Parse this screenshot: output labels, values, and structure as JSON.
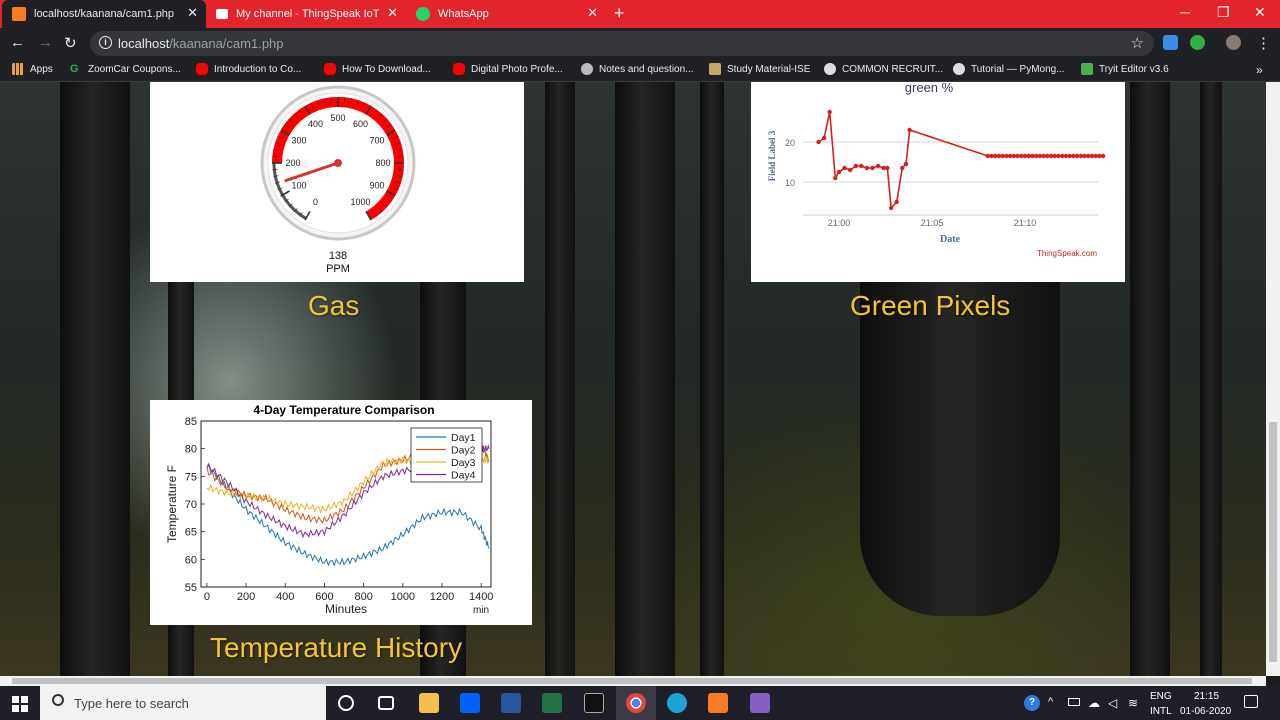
{
  "tabs": [
    {
      "title": "localhost/kaanana/cam1.php",
      "active": true,
      "icon": "xampp-icon"
    },
    {
      "title": "My channel - ThingSpeak IoT",
      "active": false,
      "icon": "thingspeak-icon"
    },
    {
      "title": "WhatsApp",
      "active": false,
      "icon": "whatsapp-icon"
    }
  ],
  "address_bar": {
    "host": "localhost",
    "path": "/kaanana/cam1.php"
  },
  "bookmarks": [
    {
      "label": "Apps",
      "icon": "apps-grid-icon"
    },
    {
      "label": "ZoomCar Coupons...",
      "icon": "g-icon"
    },
    {
      "label": "Introduction to Co...",
      "icon": "youtube-icon"
    },
    {
      "label": "How To Download...",
      "icon": "youtube-icon"
    },
    {
      "label": "Digital Photo Profe...",
      "icon": "youtube-icon"
    },
    {
      "label": "Notes and question...",
      "icon": "github-icon"
    },
    {
      "label": "Study Material-ISE",
      "icon": "image-icon"
    },
    {
      "label": "COMMON RECRUIT...",
      "icon": "globe-icon"
    },
    {
      "label": "Tutorial — PyMong...",
      "icon": "globe-icon"
    },
    {
      "label": "Tryit Editor v3.6",
      "icon": "w3-icon"
    }
  ],
  "gauge": {
    "value": 138,
    "unit": "PPM",
    "min": 0,
    "max": 1000,
    "tick_labels": [
      "0",
      "100",
      "200",
      "300",
      "400",
      "500",
      "600",
      "700",
      "800",
      "900",
      "1000"
    ],
    "red_band": [
      200,
      1000
    ],
    "caption": "Gas"
  },
  "green_chart": {
    "title": "green %",
    "xlabel": "Date",
    "ylabel": "Field Label 3",
    "x_ticks": [
      "21:00",
      "21:05",
      "21:10"
    ],
    "y_ticks": [
      "10",
      "20"
    ],
    "credit": "ThingSpeak.com",
    "caption": "Green Pixels"
  },
  "temp_chart": {
    "title": "4-Day Temperature Comparison",
    "xlabel": "Minutes",
    "ylabel": "Temperature F",
    "x_unit": "min",
    "x_ticks": [
      "0",
      "200",
      "400",
      "600",
      "800",
      "1000",
      "1200",
      "1400"
    ],
    "y_ticks": [
      "55",
      "60",
      "65",
      "70",
      "75",
      "80",
      "85"
    ],
    "caption": "Temperature History"
  },
  "chart_data": [
    {
      "type": "line",
      "title": "green %",
      "xlabel": "Date",
      "ylabel": "Field Label 3",
      "ylim": [
        0,
        28
      ],
      "x_tick_labels": [
        "21:00",
        "21:05",
        "21:10"
      ],
      "color": "#d62020",
      "series": [
        {
          "x": [
            "20:58.9",
            "20:59.2",
            "20:59.5",
            "20:59.8",
            "21:00.0",
            "21:00.3",
            "21:00.6",
            "21:00.9",
            "21:01.2",
            "21:01.5",
            "21:01.8",
            "21:02.1",
            "21:02.4",
            "21:02.6",
            "21:02.8",
            "21:03.1",
            "21:03.4",
            "21:03.6",
            "21:03.8",
            "21:08.0",
            "21:08.2",
            "21:08.4",
            "21:08.6",
            "21:08.8",
            "21:09.0",
            "21:09.2",
            "21:09.4",
            "21:09.6",
            "21:09.8",
            "21:10.0",
            "21:10.2",
            "21:10.4",
            "21:10.6",
            "21:10.8",
            "21:11.0",
            "21:11.2",
            "21:11.4",
            "21:11.6",
            "21:11.8",
            "21:12.0",
            "21:12.2",
            "21:12.4",
            "21:12.6",
            "21:12.8",
            "21:13.0",
            "21:13.2",
            "21:13.4",
            "21:13.6",
            "21:13.8",
            "21:14.0",
            "21:14.2"
          ],
          "values": [
            20,
            21,
            27.5,
            11,
            12.5,
            13.5,
            13,
            14,
            14,
            13.5,
            13.5,
            14,
            13.5,
            13.5,
            3.5,
            5,
            13.5,
            14.5,
            23,
            16.5,
            16.5,
            16.5,
            16.5,
            16.5,
            16.5,
            16.5,
            16.5,
            16.5,
            16.5,
            16.5,
            16.5,
            16.5,
            16.5,
            16.5,
            16.5,
            16.5,
            16.5,
            16.5,
            16.5,
            16.5,
            16.5,
            16.5,
            16.5,
            16.5,
            16.5,
            16.5,
            16.5,
            16.5,
            16.5,
            16.5,
            16.5
          ]
        }
      ]
    },
    {
      "type": "line",
      "title": "4-Day Temperature Comparison",
      "xlabel": "Minutes",
      "ylabel": "Temperature F",
      "xlim": [
        -30,
        1450
      ],
      "ylim": [
        55,
        85
      ],
      "legend": "top-right",
      "x": [
        0,
        100,
        200,
        300,
        400,
        500,
        600,
        700,
        800,
        900,
        1000,
        1100,
        1200,
        1300,
        1400,
        1440
      ],
      "series": [
        {
          "name": "Day1",
          "color": "#1f77b4",
          "values": [
            77,
            73,
            69,
            66,
            63,
            61,
            59.5,
            59.5,
            60.5,
            62,
            64.5,
            67.5,
            68.5,
            68.5,
            65.5,
            62
          ]
        },
        {
          "name": "Day2",
          "color": "#d95319",
          "values": [
            76,
            73,
            71.5,
            71,
            69,
            67.5,
            67,
            69,
            73,
            77,
            78,
            79,
            80,
            82,
            80.5,
            78
          ]
        },
        {
          "name": "Day3",
          "color": "#edb120",
          "values": [
            73,
            72,
            71.5,
            71,
            70,
            69.5,
            69,
            70.5,
            74,
            77.5,
            78,
            77,
            78,
            79,
            78,
            78
          ]
        },
        {
          "name": "Day4",
          "color": "#7e2f8e",
          "values": [
            77,
            74,
            70.5,
            68,
            66,
            64.5,
            65,
            68,
            72,
            75,
            76,
            76.5,
            78,
            79,
            80,
            80
          ]
        }
      ]
    }
  ],
  "taskbar": {
    "search_placeholder": "Type here to search",
    "lang": "ENG",
    "layout": "INTL",
    "time": "21:15",
    "date": "01-06-2020"
  }
}
